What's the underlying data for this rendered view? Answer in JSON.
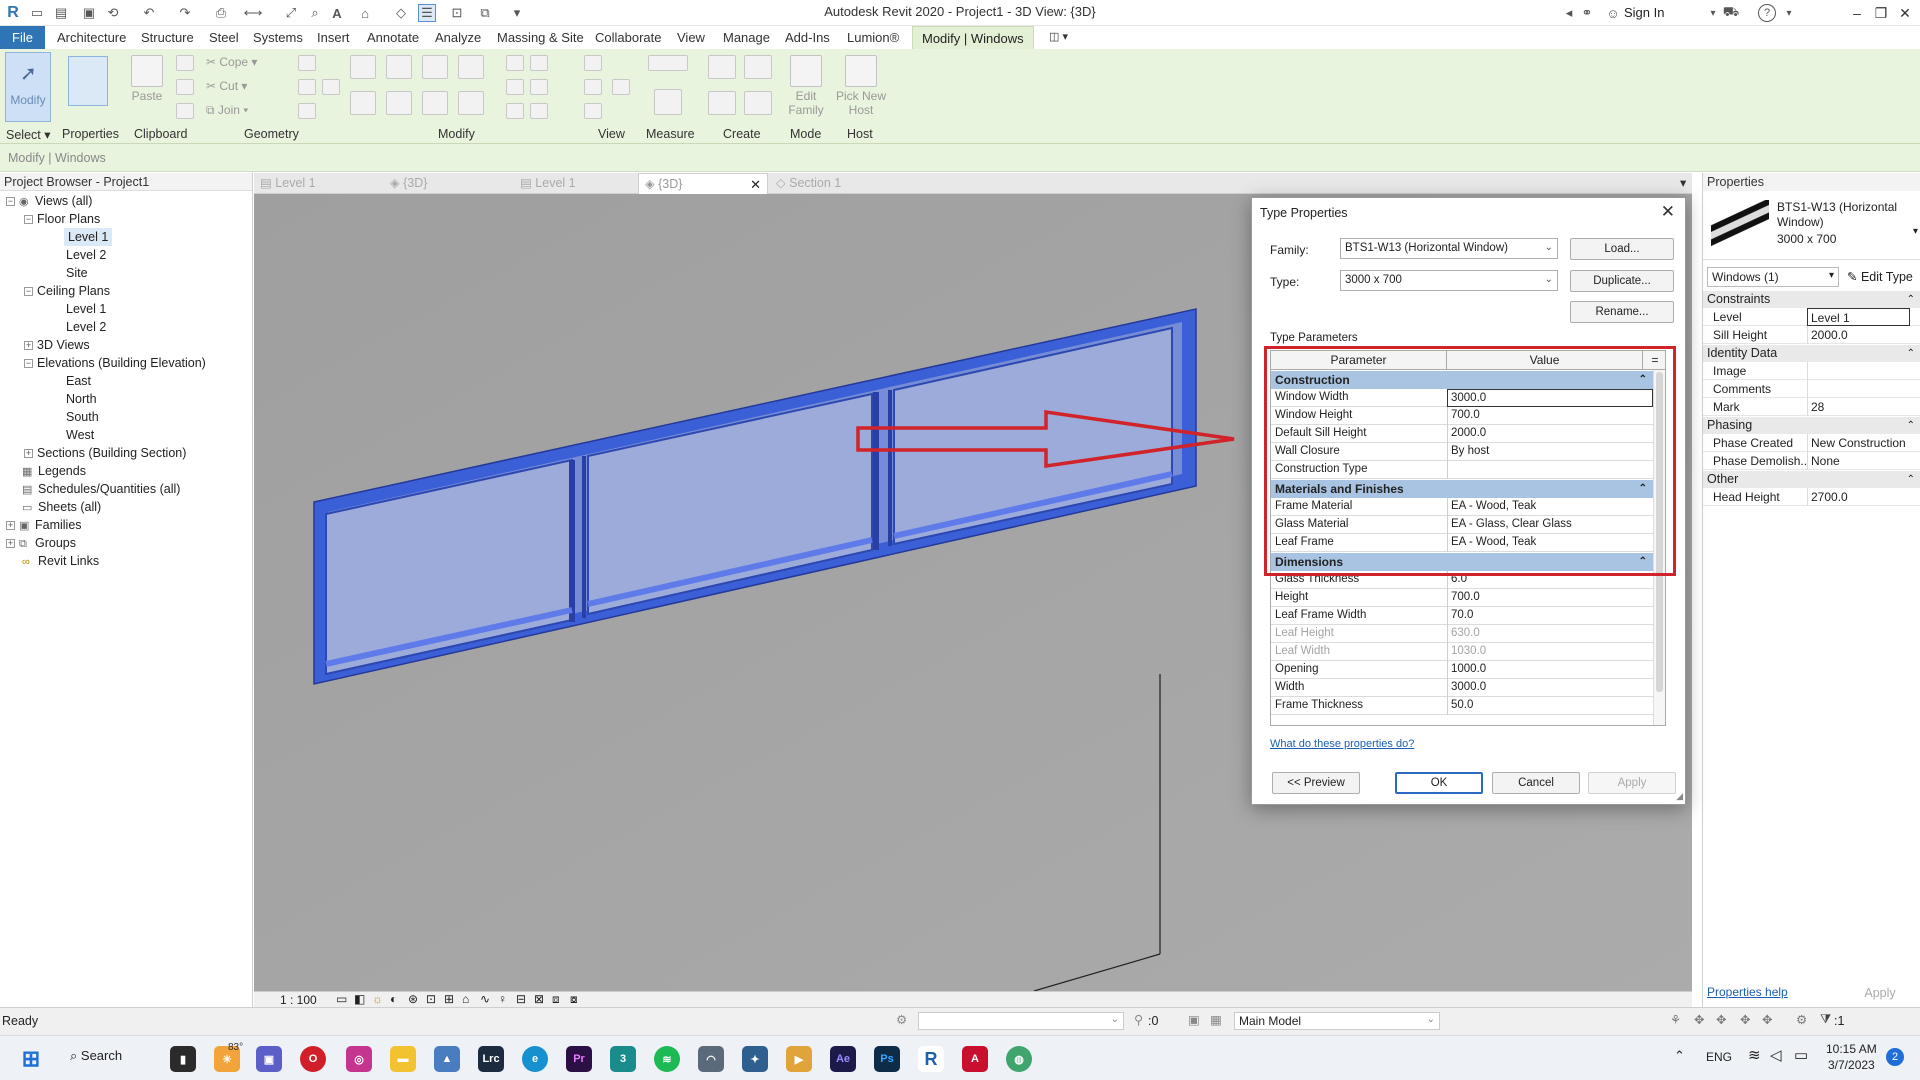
{
  "window": {
    "title": "Autodesk Revit 2020 - Project1 - 3D View: {3D}",
    "sign_in": "Sign In"
  },
  "ribbon": {
    "tabs": [
      "File",
      "Architecture",
      "Structure",
      "Steel",
      "Systems",
      "Insert",
      "Annotate",
      "Analyze",
      "Massing & Site",
      "Collaborate",
      "View",
      "Manage",
      "Add-Ins",
      "Lumion®",
      "Modify | Windows"
    ],
    "modify_label": "Modify",
    "select_label": "Select ▾",
    "properties_label": "Properties",
    "paste_label": "Paste",
    "cope_label": "Cope",
    "cut_label": "Cut",
    "join_label": "Join",
    "edit_family_label": "Edit Family",
    "pick_new_host_label": "Pick New Host",
    "panels": [
      "Clipboard",
      "Geometry",
      "Modify",
      "View",
      "Measure",
      "Create",
      "Mode",
      "Host"
    ]
  },
  "context_bar": "Modify | Windows",
  "project_browser": {
    "title": "Project Browser - Project1",
    "items": [
      "Views (all)",
      "Floor Plans",
      "Level 1",
      "Level 2",
      "Site",
      "Ceiling Plans",
      "Level 1",
      "Level 2",
      "3D Views",
      "Elevations (Building Elevation)",
      "East",
      "North",
      "South",
      "West",
      "Sections (Building Section)",
      "Legends",
      "Schedules/Quantities (all)",
      "Sheets (all)",
      "Families",
      "Groups",
      "Revit Links"
    ]
  },
  "view_tabs": [
    "Level 1",
    "{3D}",
    "Level 1",
    "{3D}",
    "Section 1"
  ],
  "view_control": {
    "scale": "1 : 100"
  },
  "dialog": {
    "title": "Type Properties",
    "family_label": "Family:",
    "family_value": "BTS1-W13 (Horizontal Window)",
    "type_label": "Type:",
    "type_value": "3000 x 700",
    "load_btn": "Load...",
    "duplicate_btn": "Duplicate...",
    "rename_btn": "Rename...",
    "type_params_label": "Type Parameters",
    "col_parameter": "Parameter",
    "col_value": "Value",
    "col_sort": "=",
    "groups": {
      "construction": "Construction",
      "materials": "Materials and Finishes",
      "dimensions": "Dimensions"
    },
    "construction_rows": [
      {
        "k": "Window Width",
        "v": "3000.0"
      },
      {
        "k": "Window Height",
        "v": "700.0"
      },
      {
        "k": "Default Sill Height",
        "v": "2000.0"
      },
      {
        "k": "Wall Closure",
        "v": "By host"
      },
      {
        "k": "Construction Type",
        "v": ""
      }
    ],
    "material_rows": [
      {
        "k": "Frame Material",
        "v": "EA - Wood, Teak"
      },
      {
        "k": "Glass Material",
        "v": "EA - Glass, Clear Glass"
      },
      {
        "k": "Leaf Frame",
        "v": "EA - Wood, Teak"
      }
    ],
    "dimension_rows": [
      {
        "k": "Glass Thickness",
        "v": "6.0"
      },
      {
        "k": "Height",
        "v": "700.0"
      },
      {
        "k": "Leaf Frame Width",
        "v": "70.0"
      },
      {
        "k": "Leaf Height",
        "v": "630.0",
        "dim": true
      },
      {
        "k": "Leaf Width",
        "v": "1030.0",
        "dim": true
      },
      {
        "k": "Opening",
        "v": "1000.0"
      },
      {
        "k": "Width",
        "v": "3000.0"
      },
      {
        "k": "Frame Thickness",
        "v": "50.0"
      }
    ],
    "help_link": "What do these properties do?",
    "preview_btn": "<< Preview",
    "ok_btn": "OK",
    "cancel_btn": "Cancel",
    "apply_btn": "Apply"
  },
  "properties_palette": {
    "title": "Properties",
    "type_name": "BTS1-W13 (Horizontal Window)",
    "type_size": "3000 x 700",
    "selector": "Windows (1)",
    "edit_type": "Edit Type",
    "groups": {
      "constraints": "Constraints",
      "identity": "Identity Data",
      "phasing": "Phasing",
      "other": "Other"
    },
    "rows": {
      "level": {
        "k": "Level",
        "v": "Level 1"
      },
      "sill": {
        "k": "Sill Height",
        "v": "2000.0"
      },
      "image": {
        "k": "Image",
        "v": ""
      },
      "comments": {
        "k": "Comments",
        "v": ""
      },
      "mark": {
        "k": "Mark",
        "v": "28"
      },
      "phase_created": {
        "k": "Phase Created",
        "v": "New Construction"
      },
      "phase_demo": {
        "k": "Phase Demolish...",
        "v": "None"
      },
      "head": {
        "k": "Head Height",
        "v": "2700.0"
      }
    },
    "help_link": "Properties help",
    "apply_btn": "Apply"
  },
  "status_bar": {
    "ready": "Ready",
    "workset_count": ":0",
    "model": "Main Model",
    "filter_count": ":1"
  },
  "taskbar": {
    "search": "Search",
    "weather": "83°",
    "lang": "ENG",
    "time": "10:15 AM",
    "date": "3/7/2023",
    "notifications": "2"
  },
  "colors": {
    "ribbon_bg": "#e9f4de",
    "file_tab": "#2f74b5",
    "canvas_bg": "#a6a6a6",
    "window_selected": "#3b5fd6",
    "highlight_red": "#d1232a",
    "group_header": "#a8c4e2"
  }
}
